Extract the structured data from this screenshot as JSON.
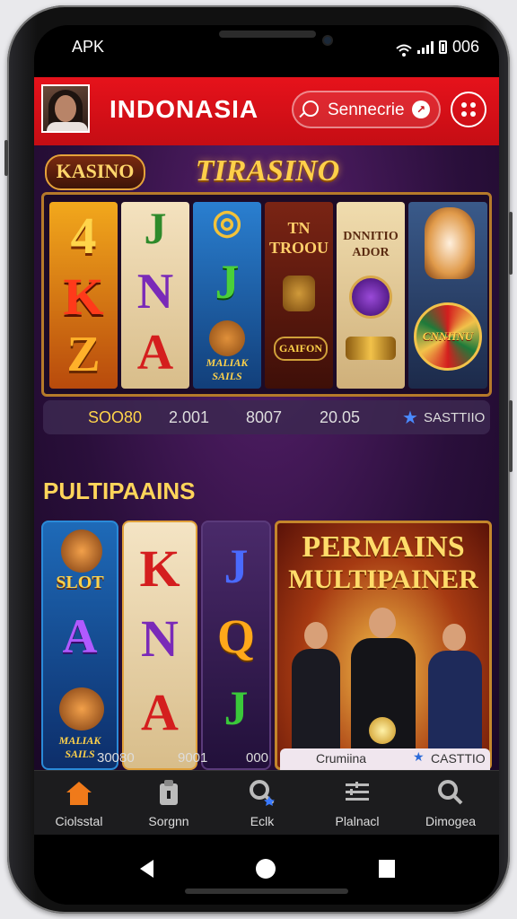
{
  "status_bar": {
    "left_text": "APK",
    "right_text": "006"
  },
  "header": {
    "brand": "INDONASIA",
    "search_placeholder": "Sennecrie"
  },
  "banner": {
    "badge": "KASINO",
    "title": "TIRASINO",
    "reels": [
      {
        "symbols": [
          "4",
          "K",
          "Z"
        ]
      },
      {
        "symbols": [
          "J",
          "N",
          "A"
        ]
      },
      {
        "symbols": [
          "◎",
          "J",
          "MALIAK SAILS"
        ]
      },
      {
        "symbols": [
          "TN TROOU",
          "GAIFON"
        ]
      },
      {
        "symbols": [
          "DNNITIO ADOR"
        ]
      },
      {
        "symbols": [
          "CNNIINU"
        ]
      }
    ],
    "stats": [
      "SOO80",
      "2.001",
      "8007",
      "20.05",
      "SASTTIIO"
    ]
  },
  "section": {
    "title": "PULTIPAAINS",
    "cards": [
      {
        "symbols": [
          "SLOT",
          "A",
          "MALIAK SAILS"
        ]
      },
      {
        "symbols": [
          "K",
          "N",
          "A"
        ]
      },
      {
        "symbols": [
          "J",
          "Q",
          "J"
        ]
      }
    ],
    "promo": {
      "line1": "PERMAINS",
      "line2": "MULTIPAINER"
    },
    "sub_stats": [
      "30080",
      "9001",
      "000"
    ],
    "promo_caption": "Crumiina",
    "promo_caption_right": "CASTTIO"
  },
  "bottom_nav": [
    {
      "label": "Ciolsstal",
      "icon": "home-icon",
      "active": true
    },
    {
      "label": "Sorgnn",
      "icon": "clipboard-icon",
      "active": false
    },
    {
      "label": "Eclk",
      "icon": "search-star-icon",
      "active": false
    },
    {
      "label": "Plalnacl",
      "icon": "list-icon",
      "active": false
    },
    {
      "label": "Dimogea",
      "icon": "search-icon",
      "active": false
    }
  ],
  "colors": {
    "header_red": "#e6121b",
    "accent_gold": "#ffcf4a",
    "nav_active": "#f07a1a",
    "background": "#2a0f3b"
  }
}
